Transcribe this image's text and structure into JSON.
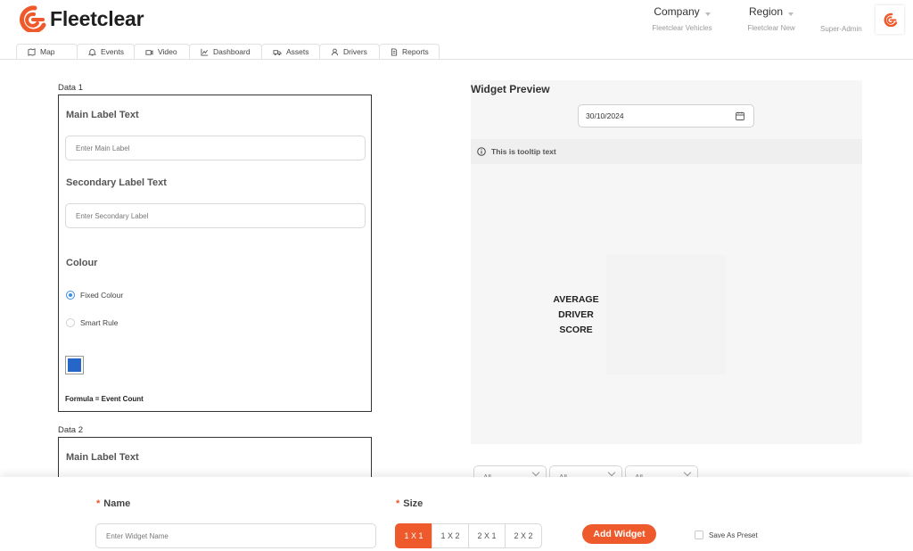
{
  "app": {
    "brand": "Fleetclear",
    "accent_color": "#ee5a2b"
  },
  "header": {
    "company": {
      "label": "Company",
      "value": "Fleetclear Vehicles"
    },
    "region": {
      "label": "Region",
      "value": "Fleetclear New"
    },
    "role": "Super-Admin"
  },
  "nav": {
    "tabs": [
      {
        "label": "Map",
        "icon": "map-icon"
      },
      {
        "label": "Events",
        "icon": "bell-icon"
      },
      {
        "label": "Video",
        "icon": "video-icon"
      },
      {
        "label": "Dashboard",
        "icon": "chart-icon"
      },
      {
        "label": "Assets",
        "icon": "truck-icon"
      },
      {
        "label": "Drivers",
        "icon": "user-icon"
      },
      {
        "label": "Reports",
        "icon": "document-icon"
      }
    ]
  },
  "data1": {
    "title": "Data 1",
    "main_label_heading": "Main Label Text",
    "main_label_placeholder": "Enter Main Label",
    "secondary_label_heading": "Secondary Label Text",
    "secondary_label_placeholder": "Enter Secondary Label",
    "colour_heading": "Colour",
    "colour_options": [
      {
        "label": "Fixed Colour",
        "selected": true
      },
      {
        "label": "Smart Rule",
        "selected": false
      }
    ],
    "swatch_color": "#2566c8",
    "formula": "Formula = Event Count"
  },
  "data2": {
    "title": "Data 2",
    "main_label_heading": "Main Label Text"
  },
  "preview": {
    "title": "Widget Preview",
    "date": "30/10/2024",
    "tooltip": "This is tooltip text",
    "metric_lines": [
      "AVERAGE",
      "DRIVER",
      "SCORE"
    ],
    "filters": [
      "All",
      "All",
      "All"
    ]
  },
  "bottom": {
    "name_label": "Name",
    "name_placeholder": "Enter Widget Name",
    "size_label": "Size",
    "sizes": [
      {
        "label": "1 X 1",
        "active": true
      },
      {
        "label": "1 X 2",
        "active": false
      },
      {
        "label": "2 X 1",
        "active": false
      },
      {
        "label": "2 X 2",
        "active": false
      }
    ],
    "add_button": "Add Widget",
    "preset_label": "Save As Preset",
    "required_mark": "*"
  }
}
